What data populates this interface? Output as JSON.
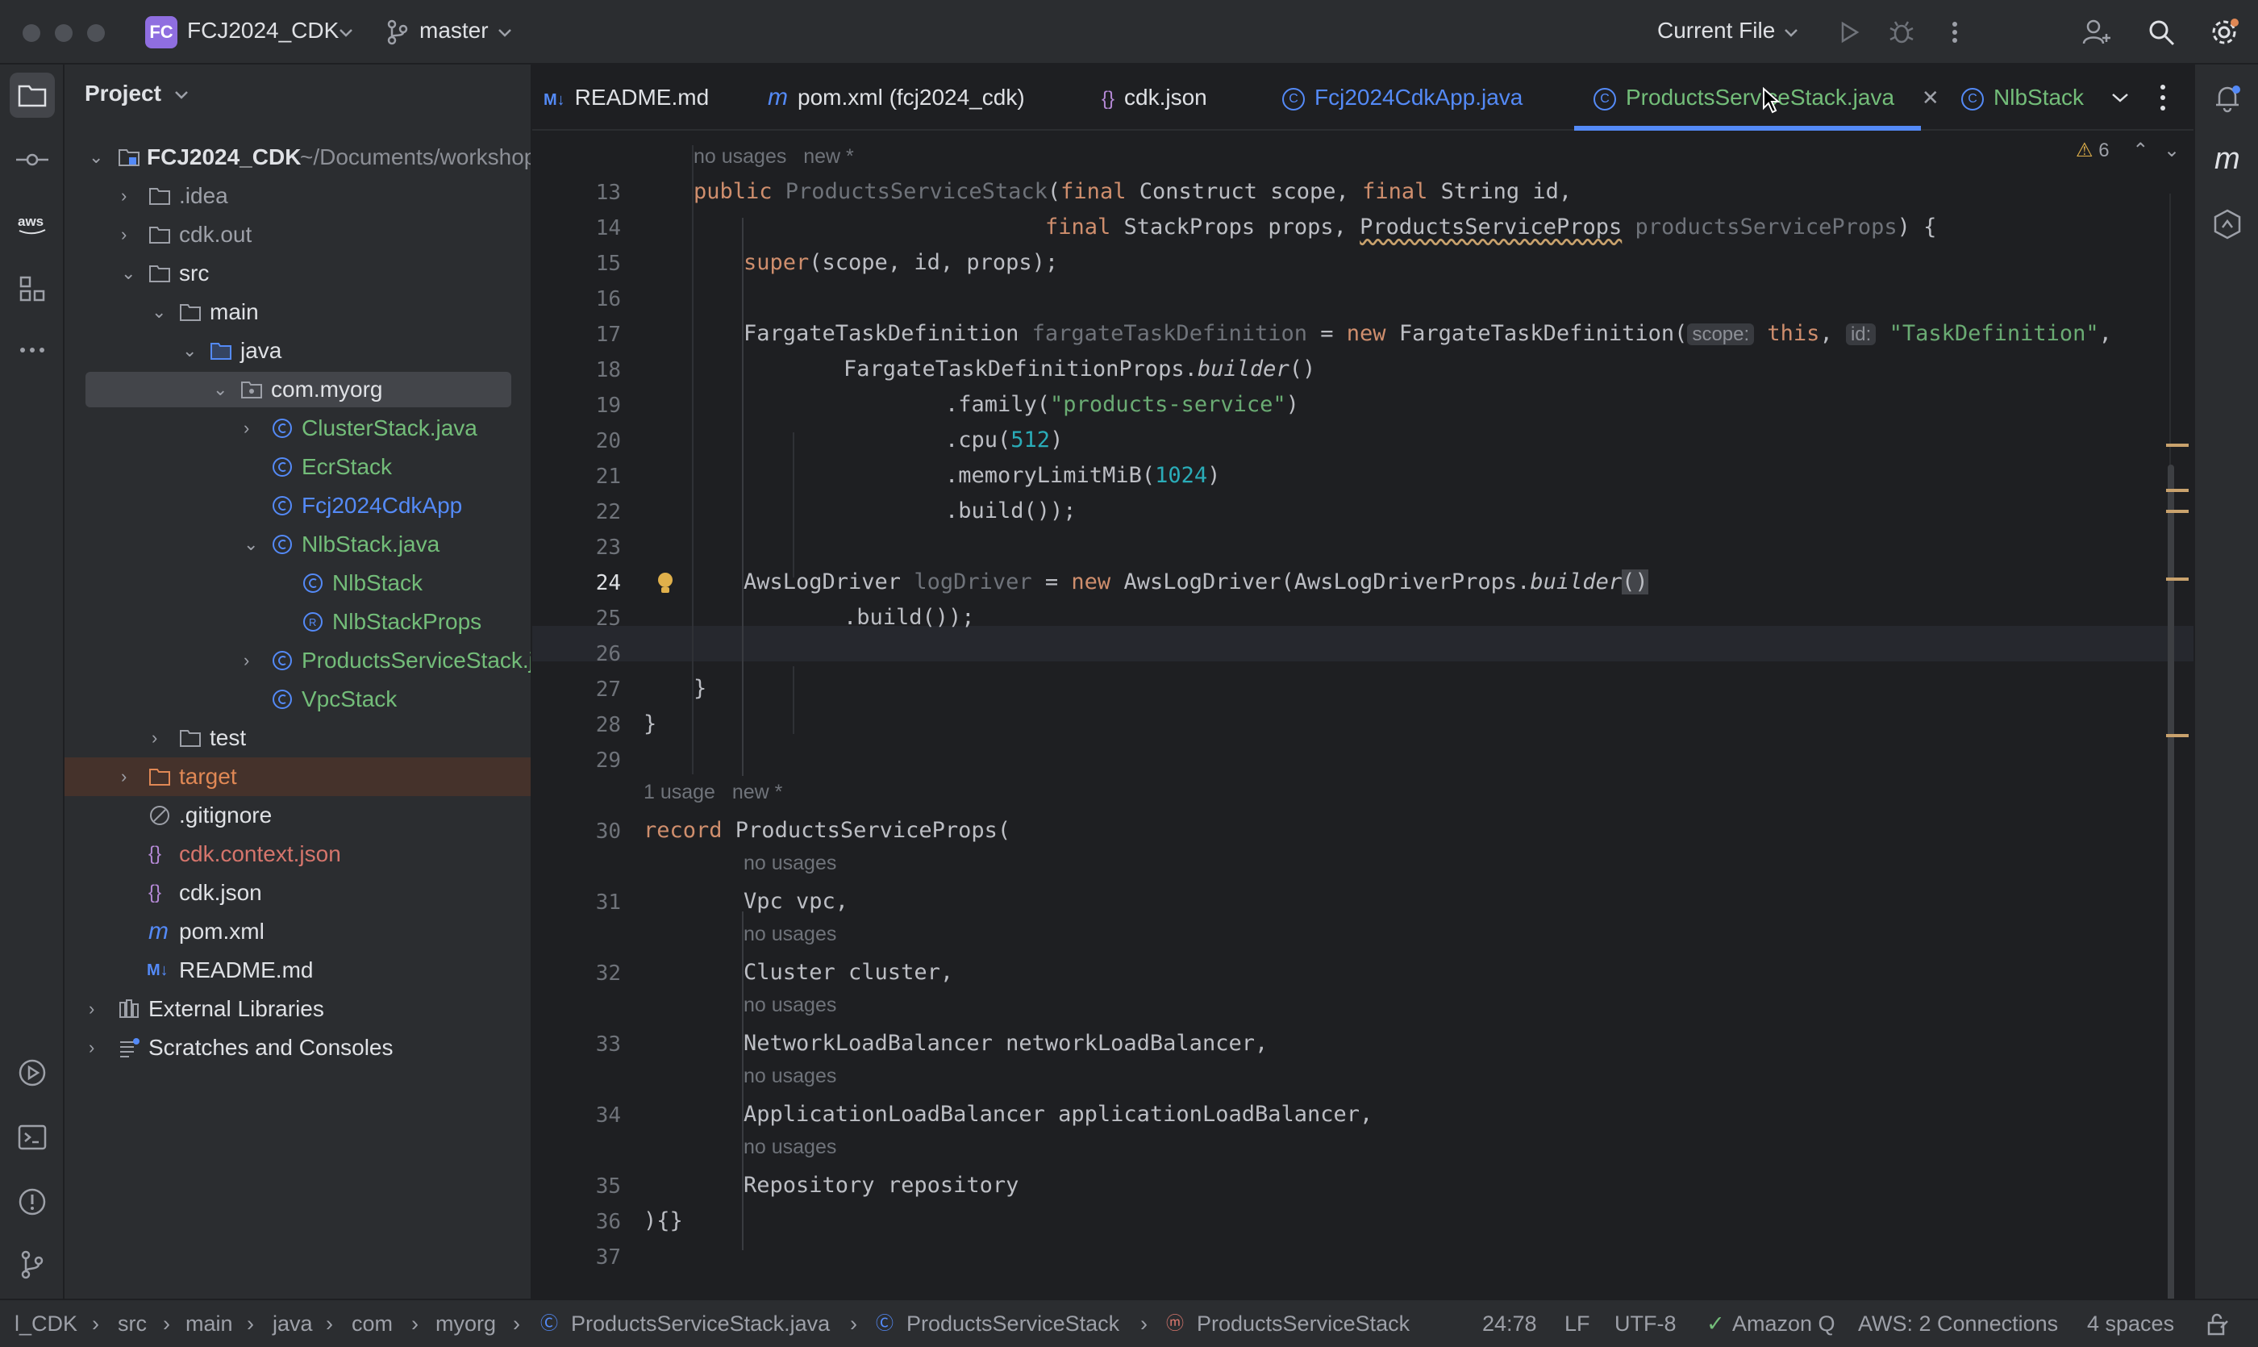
{
  "titlebar": {
    "project_badge": "FC",
    "project_name": "FCJ2024_CDK",
    "branch": "master",
    "run_config": "Current File"
  },
  "sidebar": {
    "header": "Project",
    "items": [
      {
        "label": "FCJ2024_CDK",
        "suffix": "~/Documents/workshop"
      },
      {
        "label": ".idea"
      },
      {
        "label": "cdk.out"
      },
      {
        "label": "src"
      },
      {
        "label": "main"
      },
      {
        "label": "java"
      },
      {
        "label": "com.myorg"
      },
      {
        "label": "ClusterStack.java"
      },
      {
        "label": "EcrStack"
      },
      {
        "label": "Fcj2024CdkApp"
      },
      {
        "label": "NlbStack.java"
      },
      {
        "label": "NlbStack"
      },
      {
        "label": "NlbStackProps"
      },
      {
        "label": "ProductsServiceStack.java"
      },
      {
        "label": "VpcStack"
      },
      {
        "label": "test"
      },
      {
        "label": "target"
      },
      {
        "label": ".gitignore"
      },
      {
        "label": "cdk.context.json"
      },
      {
        "label": "cdk.json"
      },
      {
        "label": "pom.xml"
      },
      {
        "label": "README.md"
      },
      {
        "label": "External Libraries"
      },
      {
        "label": "Scratches and Consoles"
      }
    ]
  },
  "tabs": [
    {
      "icon": "M↓",
      "label": "README.md"
    },
    {
      "icon": "m",
      "label": "pom.xml (fcj2024_cdk)"
    },
    {
      "icon": "{}",
      "label": "cdk.json"
    },
    {
      "icon": "C",
      "label": "Fcj2024CdkApp.java"
    },
    {
      "icon": "C",
      "label": "ProductsServiceStack.java"
    },
    {
      "icon": "C",
      "label": "NlbStack"
    }
  ],
  "editor": {
    "warnings_count": "6",
    "hints": {
      "no_usages": "no usages",
      "new": "new *",
      "one_usage": "1 usage"
    },
    "line_numbers": [
      "13",
      "14",
      "15",
      "16",
      "17",
      "18",
      "19",
      "20",
      "21",
      "22",
      "23",
      "24",
      "25",
      "26",
      "27",
      "28",
      "29",
      "30",
      "31",
      "32",
      "33",
      "34",
      "35",
      "36",
      "37"
    ],
    "code": {
      "l13_a": "public ",
      "l13_b": "ProductsServiceStack",
      "l13_c": "(",
      "l13_d": "final ",
      "l13_e": "Construct scope, ",
      "l13_f": "final ",
      "l13_g": "String id,",
      "l14_a": "final ",
      "l14_b": "StackProps props, ",
      "l14_c": "ProductsServiceProps",
      "l14_d": " productsServiceProps",
      "l14_e": ") {",
      "l15_a": "super",
      "l15_b": "(scope, id, props);",
      "l17_a": "FargateTaskDefinition ",
      "l17_b": "fargateTaskDefinition",
      "l17_c": " = ",
      "l17_d": "new ",
      "l17_e": "FargateTaskDefinition(",
      "l17_scope": "scope:",
      "l17_f": " this",
      "l17_g": ", ",
      "l17_id": "id:",
      "l17_h": " \"TaskDefinition\"",
      "l17_i": ",",
      "l18_a": "FargateTaskDefinitionProps.",
      "l18_b": "builder",
      "l18_c": "()",
      "l19_a": ".family(",
      "l19_b": "\"products-service\"",
      "l19_c": ")",
      "l20_a": ".cpu(",
      "l20_b": "512",
      "l20_c": ")",
      "l21_a": ".memoryLimitMiB(",
      "l21_b": "1024",
      "l21_c": ")",
      "l22": ".build());",
      "l24_a": "AwsLogDriver ",
      "l24_b": "logDriver",
      "l24_c": " = ",
      "l24_d": "new ",
      "l24_e": "AwsLogDriver(AwsLogDriverProps.",
      "l24_f": "builder",
      "l24_g": "()",
      "l25": ".build());",
      "l27": "}",
      "l28": "}",
      "l30_a": "record ",
      "l30_b": "ProductsServiceProps(",
      "l31": "Vpc vpc,",
      "l32": "Cluster cluster,",
      "l33": "NetworkLoadBalancer networkLoadBalancer,",
      "l34": "ApplicationLoadBalancer applicationLoadBalancer,",
      "l35": "Repository repository",
      "l36": "){}"
    }
  },
  "statusbar": {
    "breadcrumbs": [
      "l_CDK",
      "src",
      "main",
      "java",
      "com",
      "myorg",
      "ProductsServiceStack.java",
      "ProductsServiceStack",
      "ProductsServiceStack"
    ],
    "position": "24:78",
    "line_sep": "LF",
    "encoding": "UTF-8",
    "amazon_q": "Amazon Q",
    "aws": "AWS: 2 Connections",
    "indent": "4 spaces"
  },
  "colors": {
    "background": "#1e1f22",
    "panel": "#2b2d30",
    "keyword": "#cf8e6d",
    "string": "#6aab73",
    "number": "#2aacb8",
    "git_new_file": "#73bd79",
    "git_ignored": "#d5756c"
  }
}
